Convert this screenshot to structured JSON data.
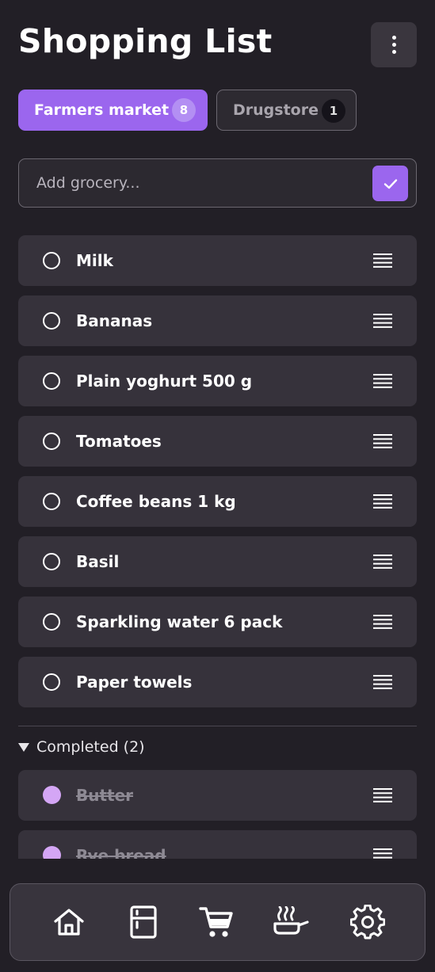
{
  "header": {
    "title": "Shopping List",
    "menu_icon": "more-vertical-icon"
  },
  "tabs": [
    {
      "label": "Farmers market",
      "count": "8",
      "active": true
    },
    {
      "label": "Drugstore",
      "count": "1",
      "active": false
    }
  ],
  "add_field": {
    "placeholder": "Add grocery...",
    "value": "",
    "submit_icon": "check-icon"
  },
  "items": [
    {
      "label": "Milk"
    },
    {
      "label": "Bananas"
    },
    {
      "label": "Plain yoghurt 500 g"
    },
    {
      "label": "Tomatoes"
    },
    {
      "label": "Coffee beans 1 kg"
    },
    {
      "label": "Basil"
    },
    {
      "label": "Sparkling water 6 pack"
    },
    {
      "label": "Paper towels"
    }
  ],
  "completed": {
    "header": "Completed (2)",
    "items": [
      {
        "label": "Butter"
      },
      {
        "label": "Rye bread"
      }
    ]
  },
  "bottom_nav": [
    "home-icon",
    "fridge-icon",
    "cart-icon",
    "cooking-pot-icon",
    "settings-icon"
  ],
  "colors": {
    "background": "#221f26",
    "accent": "#9b66ee",
    "card": "#36323b",
    "completed_dot": "#d4a6f5"
  }
}
